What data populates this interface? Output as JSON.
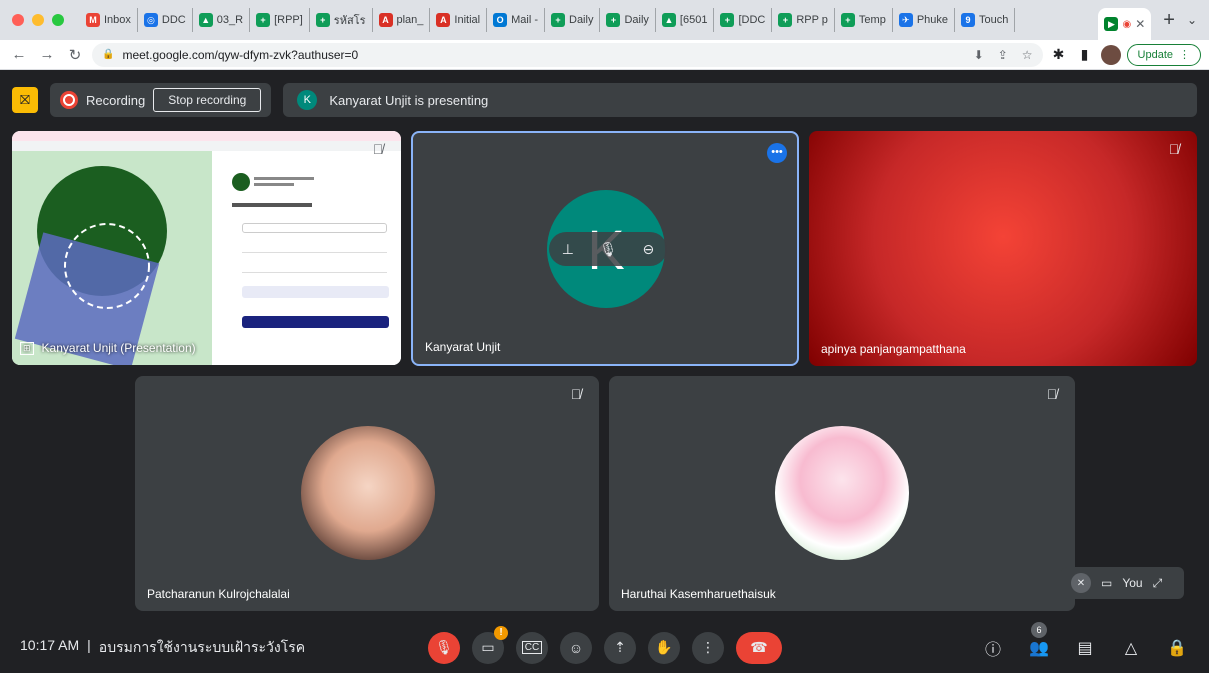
{
  "browser": {
    "tabs": [
      {
        "label": "Inbox",
        "color": "#ea4335",
        "glyph": "M"
      },
      {
        "label": "DDC",
        "color": "#1a73e8",
        "glyph": "◎"
      },
      {
        "label": "03_R",
        "color": "#0f9d58",
        "glyph": "▲"
      },
      {
        "label": "[RPP]",
        "color": "#0f9d58",
        "glyph": "+"
      },
      {
        "label": "รหัสโร",
        "color": "#0f9d58",
        "glyph": "+"
      },
      {
        "label": "plan_",
        "color": "#d93025",
        "glyph": "A"
      },
      {
        "label": "Initial",
        "color": "#d93025",
        "glyph": "A"
      },
      {
        "label": "Mail -",
        "color": "#0078d4",
        "glyph": "O"
      },
      {
        "label": "Daily",
        "color": "#0f9d58",
        "glyph": "+"
      },
      {
        "label": "Daily",
        "color": "#0f9d58",
        "glyph": "+"
      },
      {
        "label": "[6501",
        "color": "#0f9d58",
        "glyph": "▲"
      },
      {
        "label": "[DDC",
        "color": "#0f9d58",
        "glyph": "+"
      },
      {
        "label": "RPP p",
        "color": "#0f9d58",
        "glyph": "+"
      },
      {
        "label": "Temp",
        "color": "#0f9d58",
        "glyph": "+"
      },
      {
        "label": "Phuke",
        "color": "#1a73e8",
        "glyph": "✈"
      },
      {
        "label": "Touch",
        "color": "#1a73e8",
        "glyph": "9"
      }
    ],
    "active_tab_icon": "meet-icon",
    "url": "meet.google.com/qyw-dfym-zvk?authuser=0",
    "update_label": "Update"
  },
  "meet": {
    "recording_label": "Recording",
    "stop_recording_label": "Stop recording",
    "presenter_initial": "K",
    "presenting_text": "Kanyarat Unjit is presenting",
    "tiles": {
      "presentation_name": "Kanyarat Unjit (Presentation)",
      "kanyarat_name": "Kanyarat Unjit",
      "kanyarat_initial": "K",
      "apinya_name": "apinya panjangampatthana",
      "patcharanun_name": "Patcharanun Kulrojchalalai",
      "haruthai_name": "Haruthai Kasemharuethaisuk"
    },
    "self_view_label": "You",
    "participant_count": "6",
    "time": "10:17 AM",
    "separator": "|",
    "meeting_title": "อบรมการใช้งานระบบเฝ้าระวังโรค"
  },
  "colors": {
    "meet_bg": "#202124",
    "tile_bg": "#3c4043",
    "accent_red": "#ea4335",
    "active_speaker_border": "#8ab4f8",
    "avatar_teal": "#00897b",
    "recording_yellow": "#fbbc04"
  }
}
